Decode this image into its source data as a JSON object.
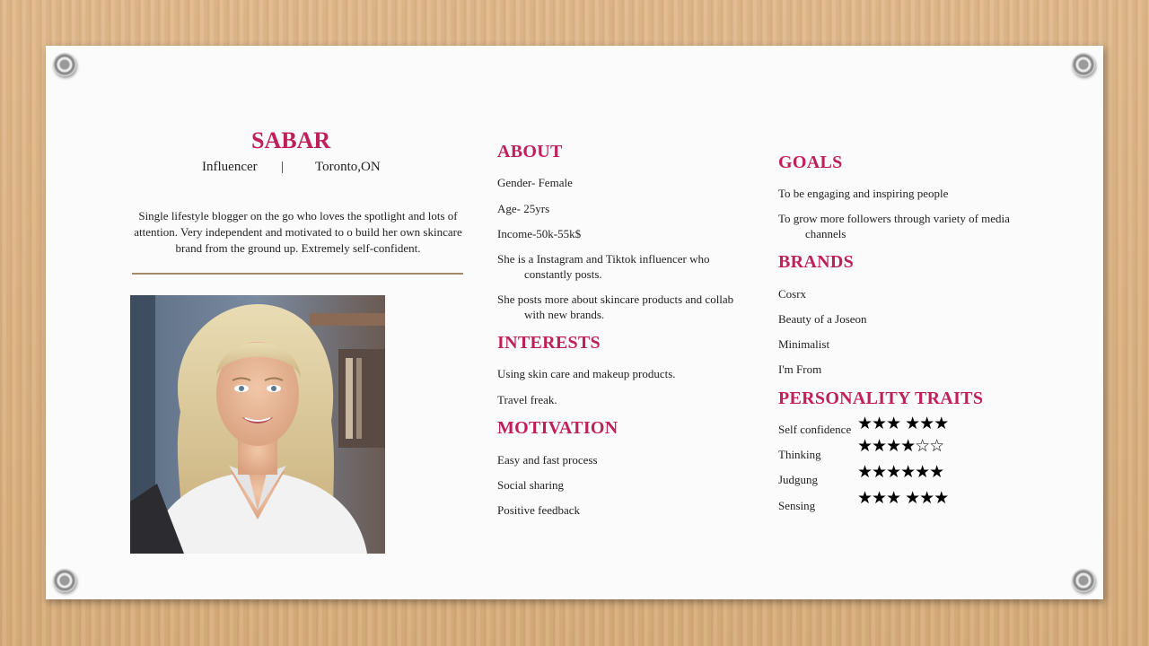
{
  "profile": {
    "name": "SABAR",
    "role": "Influencer",
    "separator": "|",
    "location": "Toronto,ON",
    "bio": "Single lifestyle blogger on the go who loves the spotlight and lots of attention. Very independent and motivated to o build her own skincare brand  from the ground up. Extremely self-confident."
  },
  "about": {
    "heading": "ABOUT",
    "gender": "Gender- Female",
    "age": "Age- 25yrs",
    "income": "Income-50k-55k$",
    "item4_line1": "She  is a Instagram and Tiktok influencer who",
    "item4_line2": "constantly posts.",
    "item5_line1": "She posts more about skincare  products and collab",
    "item5_line2": "with  new brands."
  },
  "interests": {
    "heading": "INTERESTS",
    "items": [
      "Using skin care and makeup products.",
      "Travel freak."
    ]
  },
  "motivation": {
    "heading": "MOTIVATION",
    "items": [
      "Easy and fast process",
      "Social sharing",
      "Positive feedback"
    ]
  },
  "goals": {
    "heading": "GOALS",
    "item1": "To be engaging and inspiring  people",
    "item2_line1": "To grow more followers through variety of media",
    "item2_line2": "channels"
  },
  "brands": {
    "heading": "BRANDS",
    "items": [
      "Cosrx",
      "Beauty of a Joseon",
      "Minimalist",
      "I'm From"
    ]
  },
  "personality": {
    "heading": "PERSONALITY TRAITS",
    "traits": [
      {
        "label": "Self confidence",
        "stars": "★★★ ★★★",
        "rating": 6,
        "max": 6
      },
      {
        "label": "Thinking",
        "stars": "★★★★☆☆",
        "rating": 4,
        "max": 6
      },
      {
        "label": "Judgung",
        "stars": "★★★★★★",
        "rating": 6,
        "max": 6
      },
      {
        "label": "Sensing",
        "stars": "★★★ ★★★",
        "rating": 6,
        "max": 6
      }
    ]
  },
  "colors": {
    "accent": "#c0205a",
    "rule": "#a58a6a",
    "card": "#fbfbfb"
  }
}
